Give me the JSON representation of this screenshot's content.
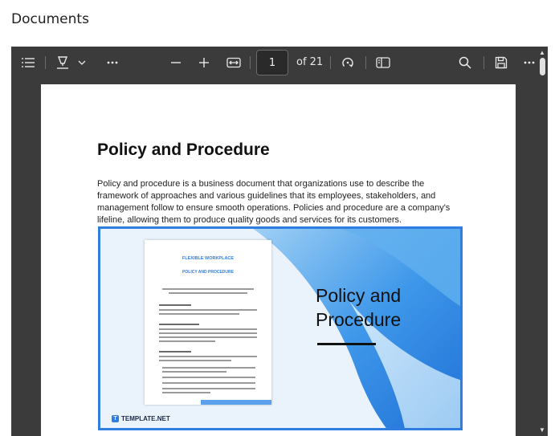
{
  "header": {
    "title": "Documents"
  },
  "toolbar": {
    "page_current": "1",
    "page_total_label": "of 21",
    "icons": [
      "contents-list-icon",
      "draw-icon",
      "chevron-down-icon",
      "more-options-icon",
      "zoom-out-icon",
      "zoom-in-icon",
      "fit-page-icon",
      "rotate-icon",
      "page-view-icon",
      "search-icon",
      "save-icon",
      "more-icon"
    ]
  },
  "document": {
    "title": "Policy and Procedure",
    "paragraph": "Policy and procedure is a business document that organizations use to describe the framework of approaches and various guidelines that its employees, stakeholders, and management follow to ensure smooth operations. Policies and procedure are a company's lifeline, allowing them to produce quality goods and services for its customers.",
    "banner": {
      "title_line1": "Policy and",
      "title_line2": "Procedure",
      "mini_heading": "FLEXIBLE WORKPLACE",
      "mini_subheading": "POLICY AND PROCEDURE",
      "brand_mark": "T",
      "brand_name": "TEMPLATE.NET"
    }
  },
  "colors": {
    "toolbar_bg": "#3b3b3b",
    "accent": "#2f7de1",
    "page_bg": "#ffffff"
  }
}
